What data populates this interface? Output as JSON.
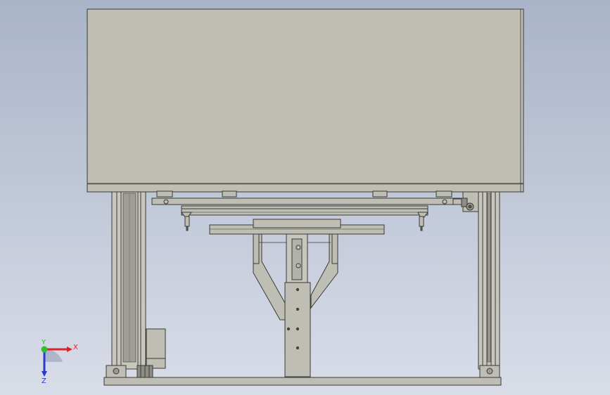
{
  "view": {
    "background_top": "#aab4c9",
    "background_bottom": "#d9dde8",
    "part_fill": "#bfbeb4",
    "part_stroke": "#3a3a36",
    "rail_fill": "#c8c7bd"
  },
  "triad": {
    "x_label": "X",
    "y_label": "Y",
    "z_label": "Z",
    "x_color": "#e0202a",
    "y_color": "#2ec02e",
    "z_color": "#2a3ad0"
  }
}
